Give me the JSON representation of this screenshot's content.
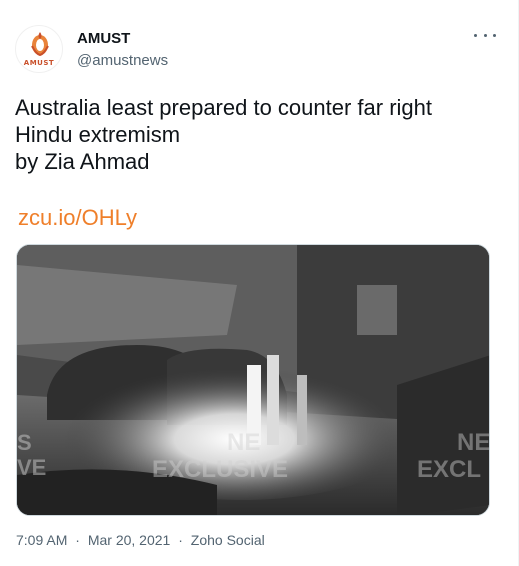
{
  "account": {
    "name": "AMUST",
    "handle": "@amustnews",
    "avatar_text": "AMUST"
  },
  "tweet": {
    "lines": [
      "Australia least prepared to counter far right",
      "Hindu extremism",
      "by Zia Ahmad"
    ],
    "link": "zcu.io/OHLy"
  },
  "media": {
    "watermark_left_top": "S",
    "watermark_left_bottom": "VE",
    "watermark_center_top": "NE",
    "watermark_center_bottom": "EXCLUSIVE",
    "watermark_right_top": "NE",
    "watermark_right_bottom": "EXCL"
  },
  "meta": {
    "time": "7:09 AM",
    "date": "Mar 20, 2021",
    "source": "Zoho Social",
    "separator": "·"
  },
  "colors": {
    "link": "#ef7f2a",
    "text": "#0f1419",
    "secondary": "#536471"
  },
  "icons": {
    "more": "more-horizontal-icon"
  }
}
